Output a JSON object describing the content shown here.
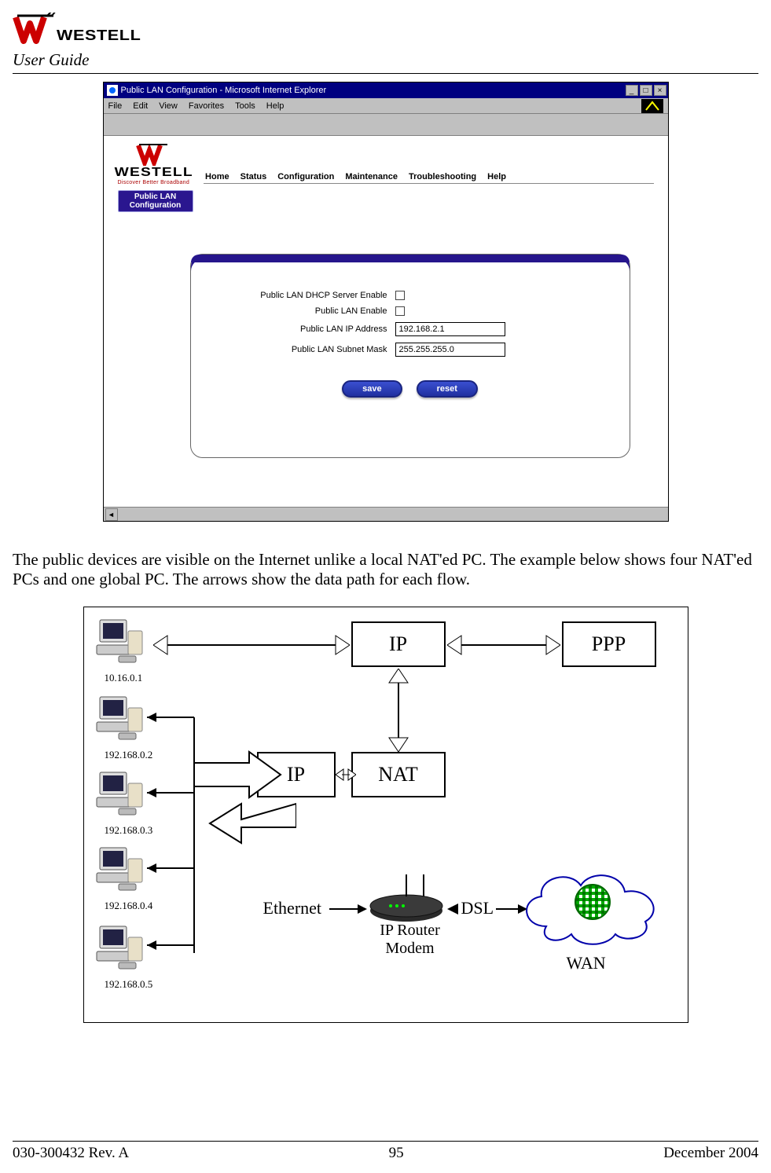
{
  "header": {
    "brand": "WESTELL",
    "subtitle": "User Guide"
  },
  "browser": {
    "title": "Public LAN Configuration - Microsoft Internet Explorer",
    "menu": [
      "File",
      "Edit",
      "View",
      "Favorites",
      "Tools",
      "Help"
    ],
    "brand": "WESTELL",
    "tagline": "Discover Better Broadband",
    "nav": [
      "Home",
      "Status",
      "Configuration",
      "Maintenance",
      "Troubleshooting",
      "Help"
    ],
    "left_button_line1": "Public LAN",
    "left_button_line2": "Configuration"
  },
  "form": {
    "f1_label": "Public LAN DHCP Server Enable",
    "f2_label": "Public LAN Enable",
    "f3_label": "Public LAN IP Address",
    "f3_value": "192.168.2.1",
    "f4_label": "Public LAN Subnet Mask",
    "f4_value": "255.255.255.0",
    "save": "save",
    "reset": "reset"
  },
  "paragraph": "The public devices are visible on the Internet unlike a local NAT'ed PC. The example below shows four NAT'ed PCs and one global PC. The arrows show the data path for each flow.",
  "diagram": {
    "pc_ips": [
      "10.16.0.1",
      "192.168.0.2",
      "192.168.0.3",
      "192.168.0.4",
      "192.168.0.5"
    ],
    "ip_top": "IP",
    "ppp": "PPP",
    "ip_mid": "IP",
    "nat": "NAT",
    "ethernet": "Ethernet",
    "dsl": "DSL",
    "router_label": "IP Router\nModem",
    "wan": "WAN"
  },
  "footer": {
    "left": "030-300432 Rev. A",
    "center": "95",
    "right": "December 2004"
  }
}
